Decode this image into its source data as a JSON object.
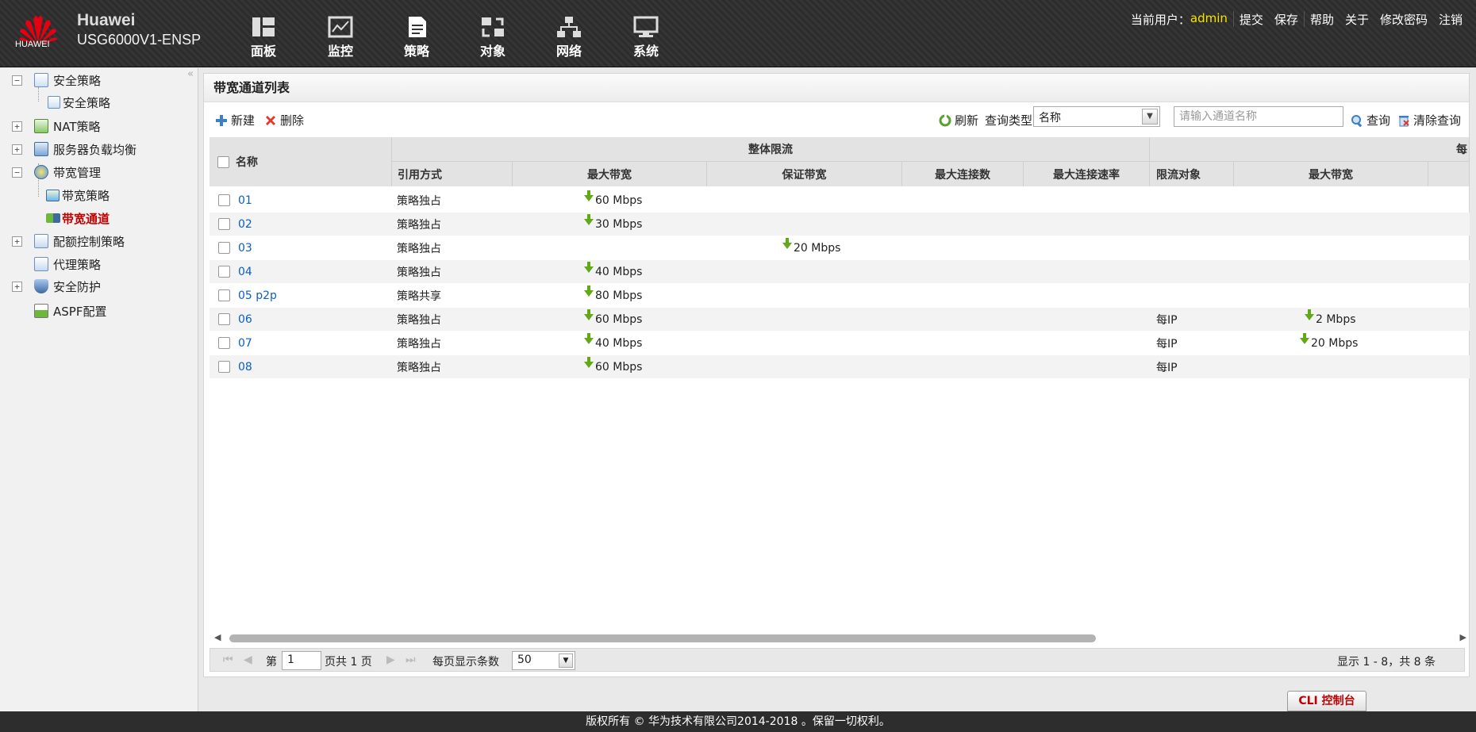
{
  "header": {
    "brand_name": "Huawei",
    "model": "USG6000V1-ENSP",
    "logo_text": "HUAWEI",
    "nav": [
      {
        "label": "面板",
        "icon": "dashboard-icon"
      },
      {
        "label": "监控",
        "icon": "monitor-icon"
      },
      {
        "label": "策略",
        "icon": "policy-icon"
      },
      {
        "label": "对象",
        "icon": "object-icon"
      },
      {
        "label": "网络",
        "icon": "network-icon"
      },
      {
        "label": "系统",
        "icon": "system-icon"
      }
    ],
    "user_label": "当前用户：",
    "user_name": "admin",
    "links": [
      "提交",
      "保存",
      "帮助",
      "关于",
      "修改密码",
      "注销"
    ]
  },
  "sidebar": {
    "items": [
      {
        "label": "安全策略",
        "toggle": "−"
      },
      {
        "label": "安全策略"
      },
      {
        "label": "NAT策略",
        "toggle": "+"
      },
      {
        "label": "服务器负载均衡",
        "toggle": "+"
      },
      {
        "label": "带宽管理",
        "toggle": "−"
      },
      {
        "label": "带宽策略"
      },
      {
        "label": "带宽通道",
        "active": true
      },
      {
        "label": "配额控制策略",
        "toggle": "+"
      },
      {
        "label": "代理策略"
      },
      {
        "label": "安全防护",
        "toggle": "+"
      },
      {
        "label": "ASPF配置"
      }
    ],
    "collapse_glyph": "«"
  },
  "panel": {
    "title": "带宽通道列表",
    "toolbar": {
      "new_label": "新建",
      "delete_label": "删除",
      "refresh_label": "刷新",
      "query_type_label": "查询类型",
      "query_type_value": "名称",
      "search_placeholder": "请输入通道名称",
      "query_label": "查询",
      "clear_label": "清除查询"
    }
  },
  "table": {
    "group_headers": {
      "overall": "整体限流",
      "partial": "每"
    },
    "columns": {
      "name": "名称",
      "ref_mode": "引用方式",
      "max_bw": "最大带宽",
      "guaranteed_bw": "保证带宽",
      "max_conn": "最大连接数",
      "max_conn_rate": "最大连接速率",
      "limit_target": "限流对象",
      "per_max_bw": "最大带宽"
    },
    "rows": [
      {
        "name": "01",
        "ref_mode": "策略独占",
        "max_bw": "60 Mbps",
        "guaranteed_bw": "",
        "limit_target": "",
        "per_max_bw": ""
      },
      {
        "name": "02",
        "ref_mode": "策略独占",
        "max_bw": "30 Mbps",
        "guaranteed_bw": "",
        "limit_target": "",
        "per_max_bw": ""
      },
      {
        "name": "03",
        "ref_mode": "策略独占",
        "max_bw": "",
        "guaranteed_bw": "20 Mbps",
        "limit_target": "",
        "per_max_bw": ""
      },
      {
        "name": "04",
        "ref_mode": "策略独占",
        "max_bw": "40 Mbps",
        "guaranteed_bw": "",
        "limit_target": "",
        "per_max_bw": ""
      },
      {
        "name": "05 p2p",
        "ref_mode": "策略共享",
        "max_bw": "80 Mbps",
        "guaranteed_bw": "",
        "limit_target": "",
        "per_max_bw": ""
      },
      {
        "name": "06",
        "ref_mode": "策略独占",
        "max_bw": "60 Mbps",
        "guaranteed_bw": "",
        "limit_target": "每IP",
        "per_max_bw": "2 Mbps"
      },
      {
        "name": "07",
        "ref_mode": "策略独占",
        "max_bw": "40 Mbps",
        "guaranteed_bw": "",
        "limit_target": "每IP",
        "per_max_bw": "20 Mbps"
      },
      {
        "name": "08",
        "ref_mode": "策略独占",
        "max_bw": "60 Mbps",
        "guaranteed_bw": "",
        "limit_target": "每IP",
        "per_max_bw": ""
      }
    ]
  },
  "pager": {
    "page_prefix": "第",
    "page_value": "1",
    "page_suffix": "页共 1 页",
    "per_page_label": "每页显示条数",
    "per_page_value": "50",
    "summary": "显示 1 - 8，共 8 条"
  },
  "cli_label": "CLI 控制台",
  "footer": "版权所有 © 华为技术有限公司2014-2018 。保留一切权利。",
  "colors": {
    "accent": "#c00000",
    "link": "#0b60c0",
    "admin": "#f5e400",
    "arrow": "#62a817"
  }
}
